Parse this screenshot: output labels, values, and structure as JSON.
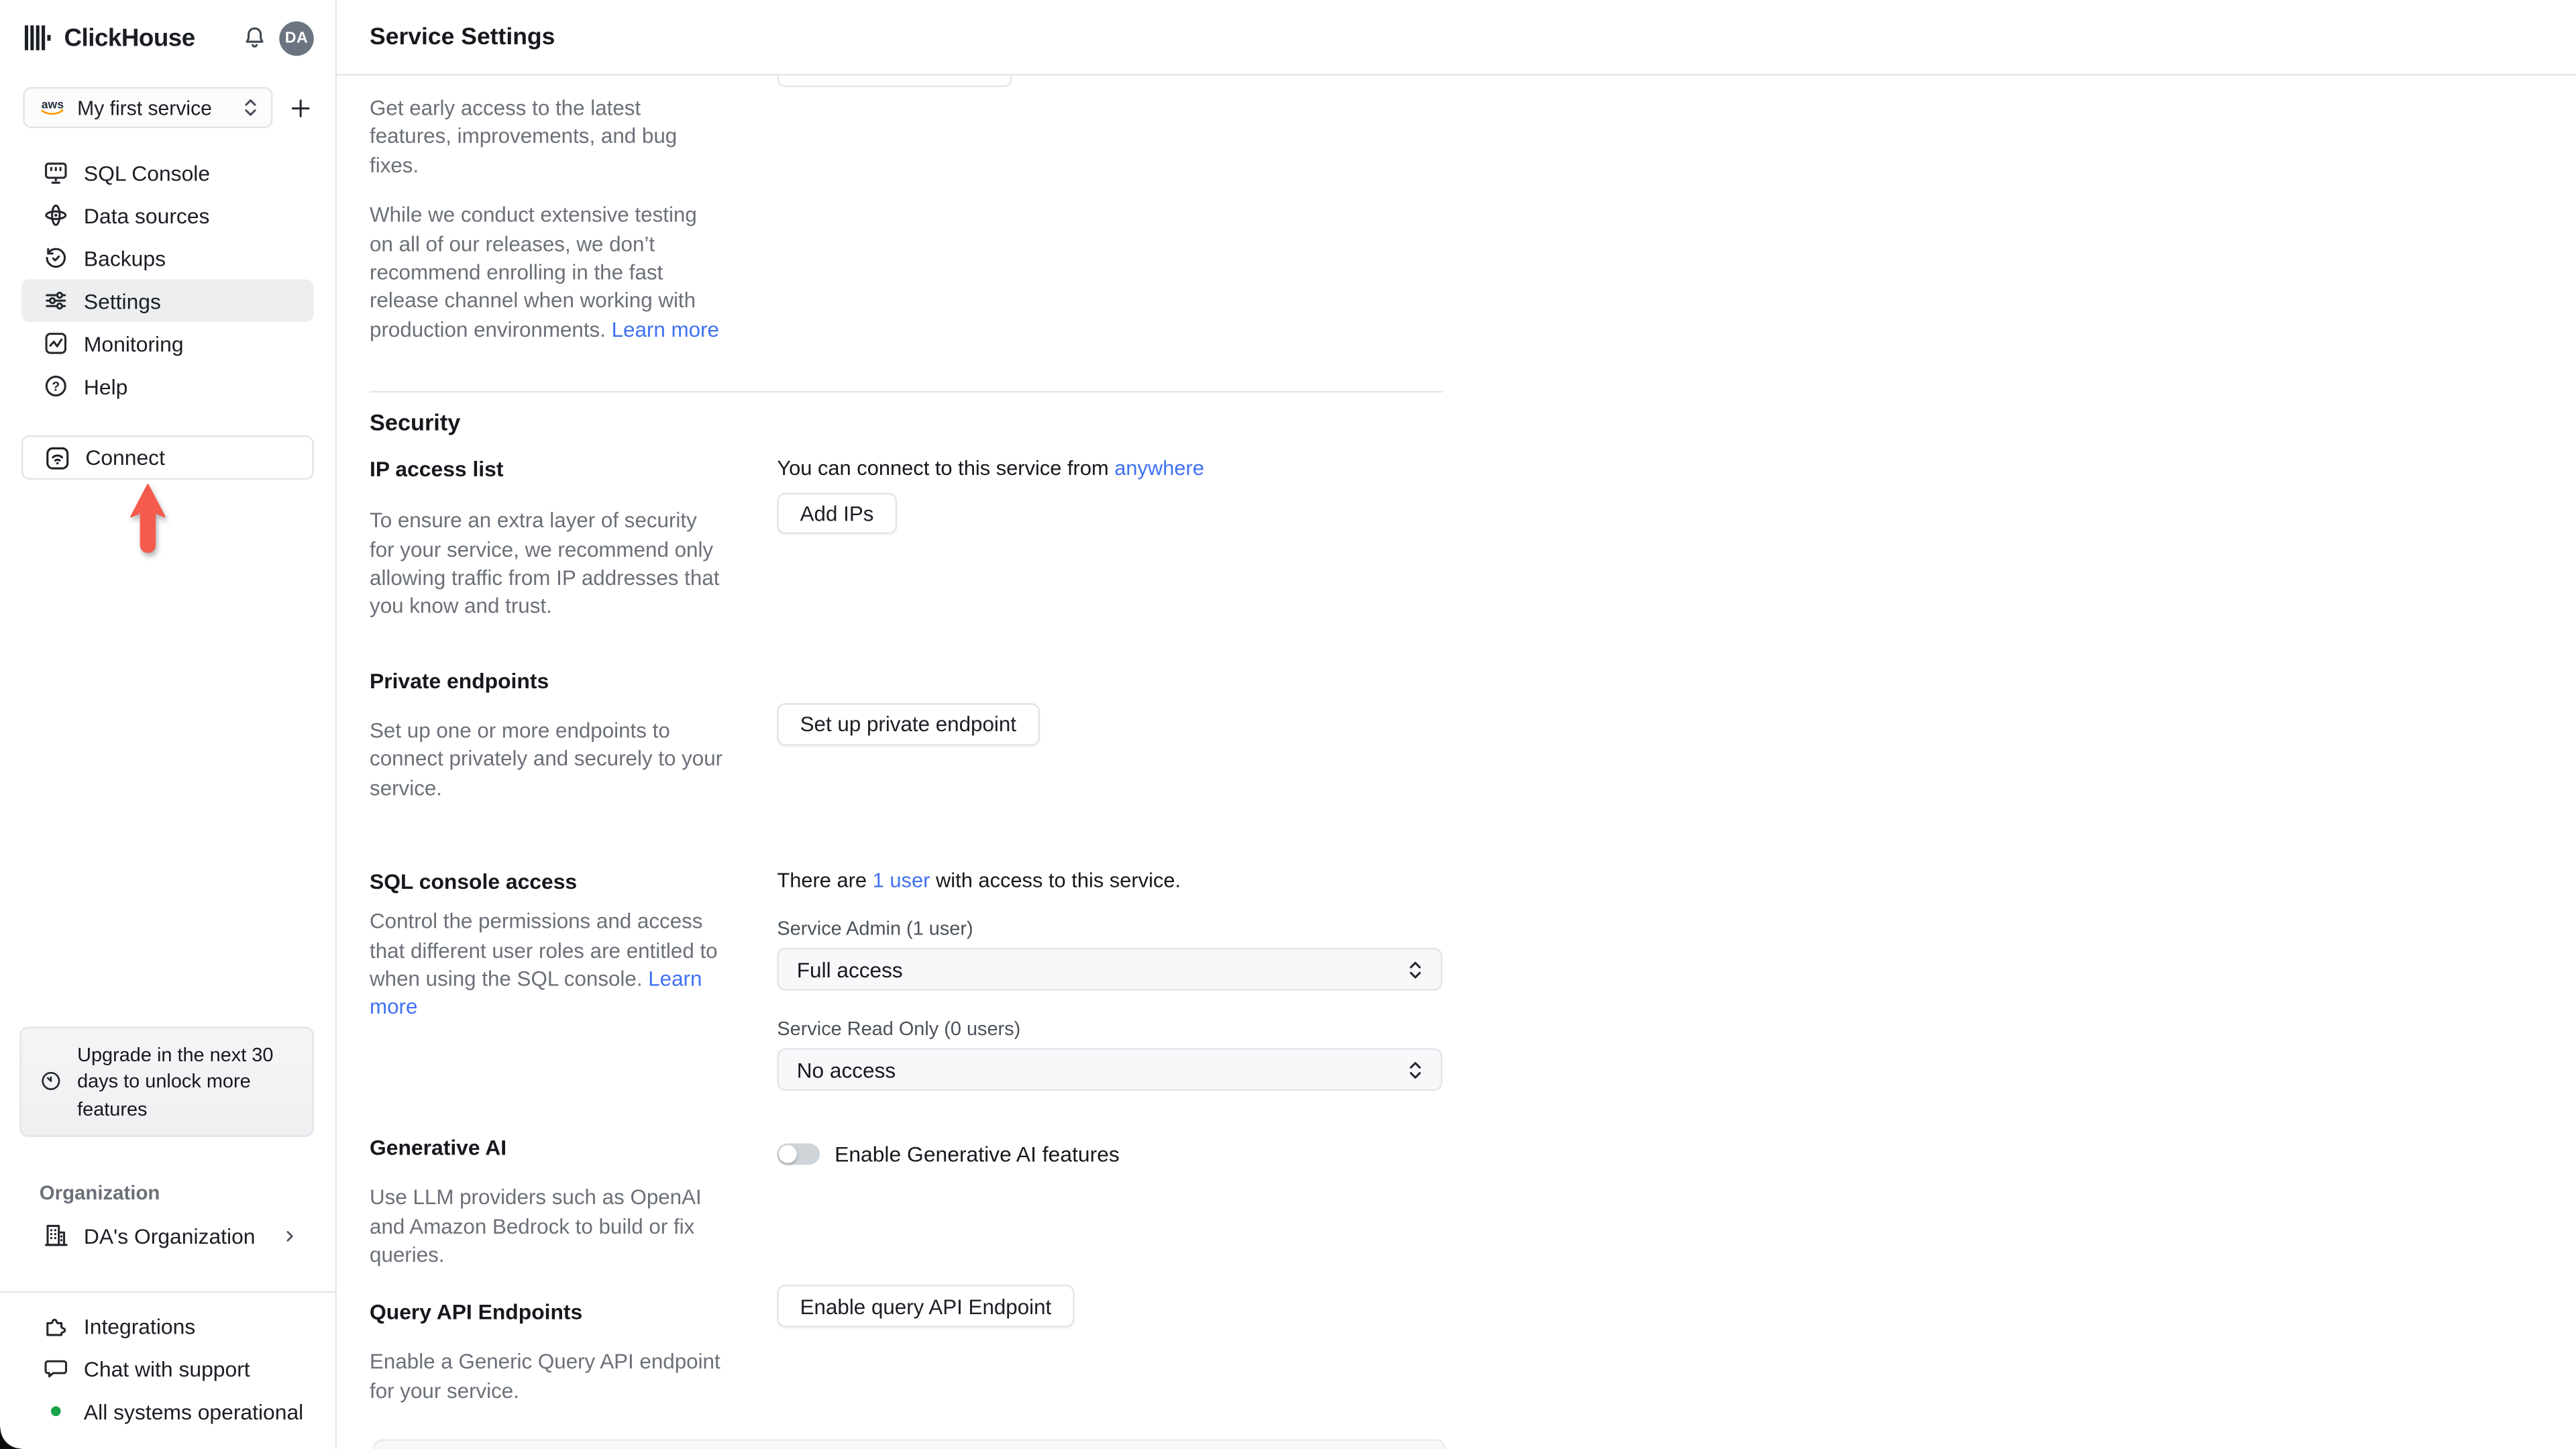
{
  "colors": {
    "accent_link": "#3f71f2",
    "status_green": "#17a34a",
    "annotation_arrow_red": "#f45b4d",
    "avatar_bg": "#6b7480",
    "active_item_bg": "#eceef0"
  },
  "sidebar": {
    "brand": "ClickHouse",
    "avatar_initials": "DA",
    "service_selector": {
      "label": "My first service",
      "provider_icon": "aws-icon"
    },
    "nav": [
      {
        "label": "SQL Console",
        "icon": "sql-console-icon"
      },
      {
        "label": "Data sources",
        "icon": "data-sources-icon"
      },
      {
        "label": "Backups",
        "icon": "backups-icon"
      },
      {
        "label": "Settings",
        "icon": "settings-icon",
        "active": true
      },
      {
        "label": "Monitoring",
        "icon": "monitoring-icon"
      },
      {
        "label": "Help",
        "icon": "help-icon"
      }
    ],
    "connect_label": "Connect",
    "upgrade_notice": "Upgrade in the next 30 days to unlock more features",
    "organization_heading": "Organization",
    "organization_name": "DA's Organization",
    "footer": [
      {
        "label": "Integrations",
        "icon": "integrations-icon"
      },
      {
        "label": "Chat with support",
        "icon": "chat-icon"
      },
      {
        "label": "All systems operational",
        "icon": "status-dot"
      }
    ]
  },
  "header": {
    "title": "Service Settings"
  },
  "release_channel": {
    "p1": "Get early access to the latest features, improvements, and bug fixes.",
    "p2": "While we conduct extensive testing on all of our releases, we don’t recommend enrolling in the fast release channel when working with production environments. ",
    "learn_more_label": "Learn more"
  },
  "security": {
    "heading": "Security",
    "ip_access": {
      "title": "IP access list",
      "description": "To ensure an extra layer of security for your service, we recommend only allowing traffic from IP addresses that you know and trust.",
      "status_prefix": "You can connect to this service from ",
      "status_link": "anywhere",
      "button_label": "Add IPs"
    },
    "private_endpoints": {
      "title": "Private endpoints",
      "description": "Set up one or more endpoints to connect privately and securely to your service.",
      "button_label": "Set up private endpoint"
    },
    "sql_console_access": {
      "title": "SQL console access",
      "description": "Control the permissions and access that different user roles are entitled to when using the SQL console. ",
      "learn_more_label": "Learn more",
      "status_prefix": "There are ",
      "status_link": "1 user",
      "status_suffix": " with access to this service.",
      "admin_label": "Service Admin (1 user)",
      "admin_value": "Full access",
      "readonly_label": "Service Read Only (0 users)",
      "readonly_value": "No access"
    },
    "generative_ai": {
      "title": "Generative AI",
      "description": "Use LLM providers such as OpenAI and Amazon Bedrock to build or fix queries.",
      "toggle_label": "Enable Generative AI features",
      "toggle_state": "off"
    },
    "query_api": {
      "title": "Query API Endpoints",
      "description": "Enable a Generic Query API endpoint for your service.",
      "button_label": "Enable query API Endpoint"
    }
  }
}
